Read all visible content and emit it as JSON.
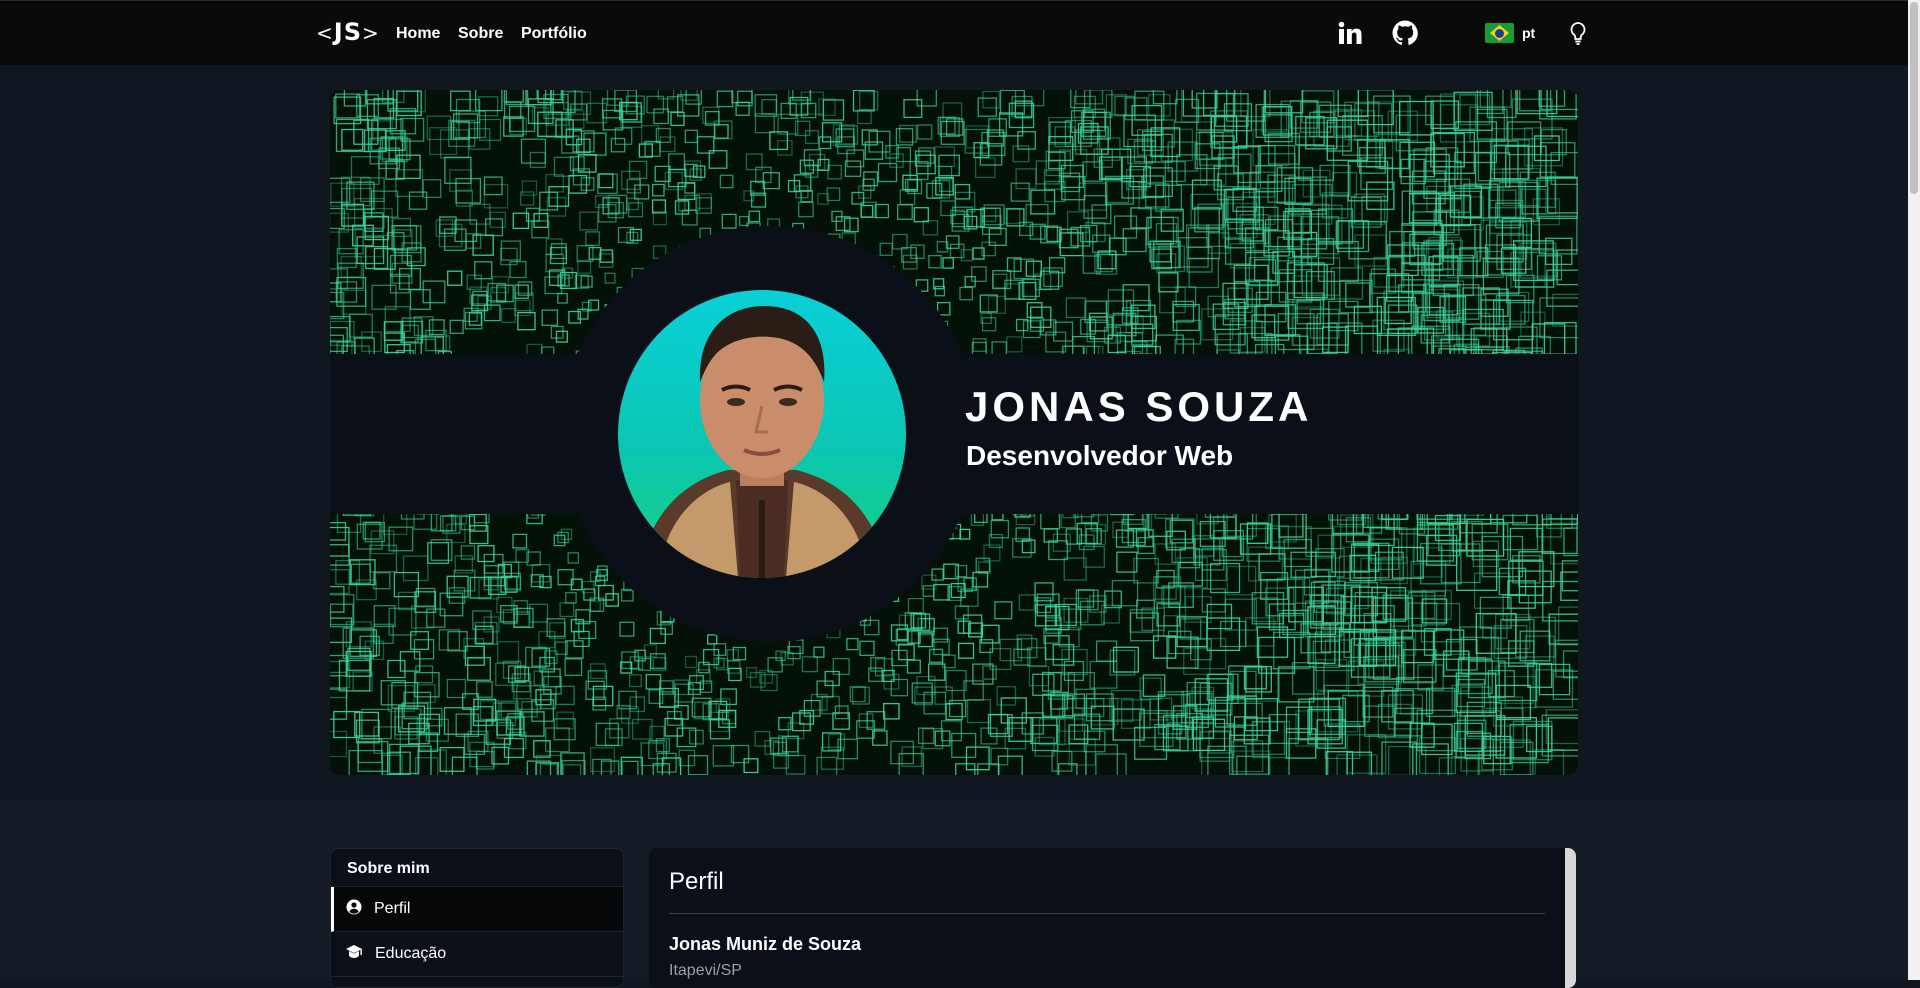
{
  "nav": {
    "logo": "JS",
    "links": [
      "Home",
      "Sobre",
      "Portfólio"
    ],
    "lang": "pt",
    "icons": [
      "linkedin-icon",
      "github-icon",
      "brazil-flag-icon",
      "lightbulb-icon"
    ]
  },
  "hero": {
    "name": "JONAS SOUZA",
    "role": "Desenvolvedor Web"
  },
  "sidebar": {
    "title": "Sobre mim",
    "items": [
      {
        "label": "Perfil",
        "icon": "user-circle-icon",
        "active": true
      },
      {
        "label": "Educação",
        "icon": "graduation-icon",
        "active": false
      }
    ]
  },
  "panel": {
    "title": "Perfil",
    "full_name": "Jonas Muniz de Souza",
    "city": "Itapevi/SP"
  },
  "colors": {
    "topbar": "#0a0a0b",
    "page": "#111720",
    "card": "#0b0f17",
    "grid_accent": "#3fd39a"
  }
}
